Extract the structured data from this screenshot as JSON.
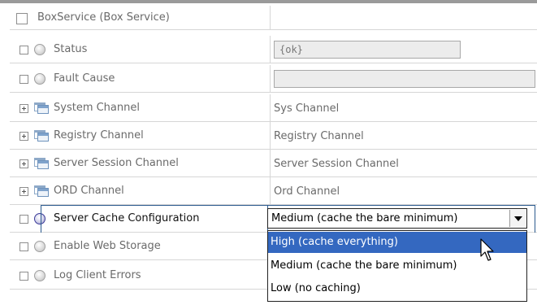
{
  "header": {
    "title": "BoxService  (Box Service)"
  },
  "rows": [
    {
      "label": "Status",
      "value": "{ok}"
    },
    {
      "label": "Fault Cause",
      "value": ""
    },
    {
      "label": "System Channel",
      "value": "Sys Channel"
    },
    {
      "label": "Registry Channel",
      "value": "Registry Channel"
    },
    {
      "label": "Server Session Channel",
      "value": "Server Session Channel"
    },
    {
      "label": "ORD Channel",
      "value": "Ord Channel"
    },
    {
      "label": "Server Cache Configuration",
      "value": "Medium (cache the bare minimum)"
    },
    {
      "label": "Enable Web Storage",
      "value": ""
    },
    {
      "label": "Log Client Errors",
      "value": ""
    }
  ],
  "dropdown": {
    "options": [
      "High (cache everything)",
      "Medium (cache the bare minimum)",
      "Low (no caching)"
    ],
    "highlighted_index": 0
  },
  "icons": {
    "property": "property-circle-icon",
    "channel": "channel-window-icon",
    "expand": "expand-plus-icon",
    "cursor": "arrow-cursor-icon"
  },
  "colors": {
    "highlight": "#3468c0",
    "focus_border": "#2c5b8f"
  }
}
